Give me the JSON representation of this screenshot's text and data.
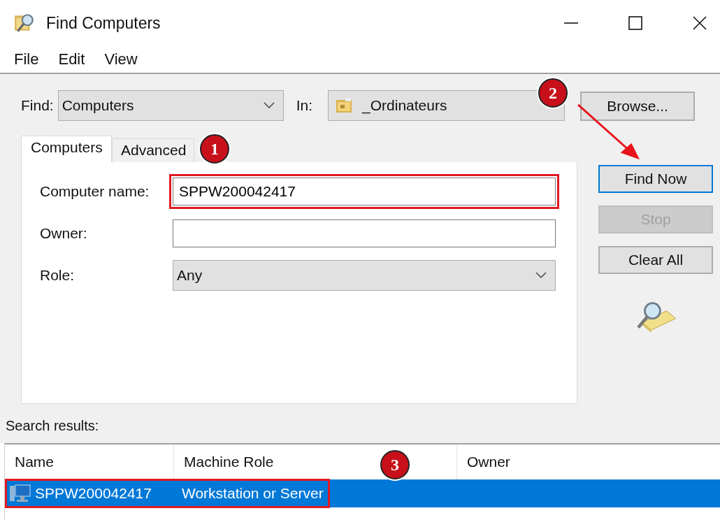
{
  "window": {
    "title": "Find Computers"
  },
  "menu": [
    "File",
    "Edit",
    "View"
  ],
  "find": {
    "label": "Find:",
    "value": "Computers"
  },
  "in": {
    "label": "In:",
    "value": "_Ordinateurs"
  },
  "browse_button": "Browse...",
  "tabs": [
    {
      "label": "Computers",
      "selected": true
    },
    {
      "label": "Advanced",
      "selected": false
    }
  ],
  "fields": [
    {
      "kind": "text",
      "label": "Computer name:",
      "value": "SPPW200042417",
      "highlighted": true
    },
    {
      "kind": "text",
      "label": "Owner:",
      "highlighted": false
    },
    {
      "kind": "select",
      "label": "Role:",
      "value": "Any",
      "highlighted": false
    }
  ],
  "buttons": [
    {
      "label": "Find Now",
      "focused": true,
      "disabled": false
    },
    {
      "label": "Stop",
      "focused": false,
      "disabled": true
    },
    {
      "label": "Clear All",
      "focused": false,
      "disabled": false
    }
  ],
  "results": {
    "label": "Search results:",
    "columns": [
      "Name",
      "Machine Role",
      "Owner"
    ],
    "rows": [
      {
        "name": "SPPW200042417",
        "role": "Workstation or Server",
        "selected": true,
        "highlighted": true
      }
    ]
  },
  "annotations": {
    "markers": [
      "1",
      "2",
      "3"
    ],
    "arrow": true
  }
}
